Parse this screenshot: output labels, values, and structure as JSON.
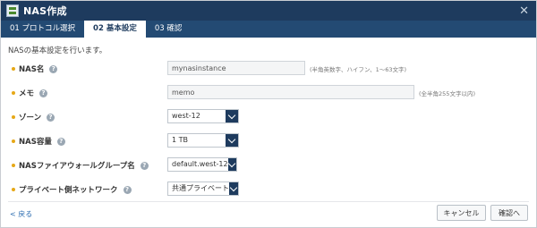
{
  "window": {
    "title": "NAS作成",
    "close_icon": "close-icon"
  },
  "tabs": [
    {
      "label": "01 プロトコル選択"
    },
    {
      "label": "02 基本設定"
    },
    {
      "label": "03 確認"
    }
  ],
  "intro": "NASの基本設定を行います。",
  "form": {
    "nas_name": {
      "label": "NAS名",
      "value": "mynasinstance",
      "hint": "(半角英数字、ハイフン、1～63文字)"
    },
    "memo": {
      "label": "メモ",
      "value": "memo",
      "hint": "(全半角255文字以内)"
    },
    "zone": {
      "label": "ゾーン",
      "value": "west-12"
    },
    "capacity": {
      "label": "NAS容量",
      "value": "1 TB"
    },
    "firewall": {
      "label": "NASファイアウォールグループ名",
      "value": "default.west-12"
    },
    "private_network": {
      "label": "プライベート側ネットワーク",
      "value": "共通プライベート"
    }
  },
  "footer": {
    "back": "< 戻る",
    "cancel": "キャンセル",
    "next": "確認へ"
  },
  "colors": {
    "titlebar": "#1e3b5e",
    "tabbar": "#234a73",
    "bullet": "#e6a817",
    "link": "#2b6cb0"
  }
}
